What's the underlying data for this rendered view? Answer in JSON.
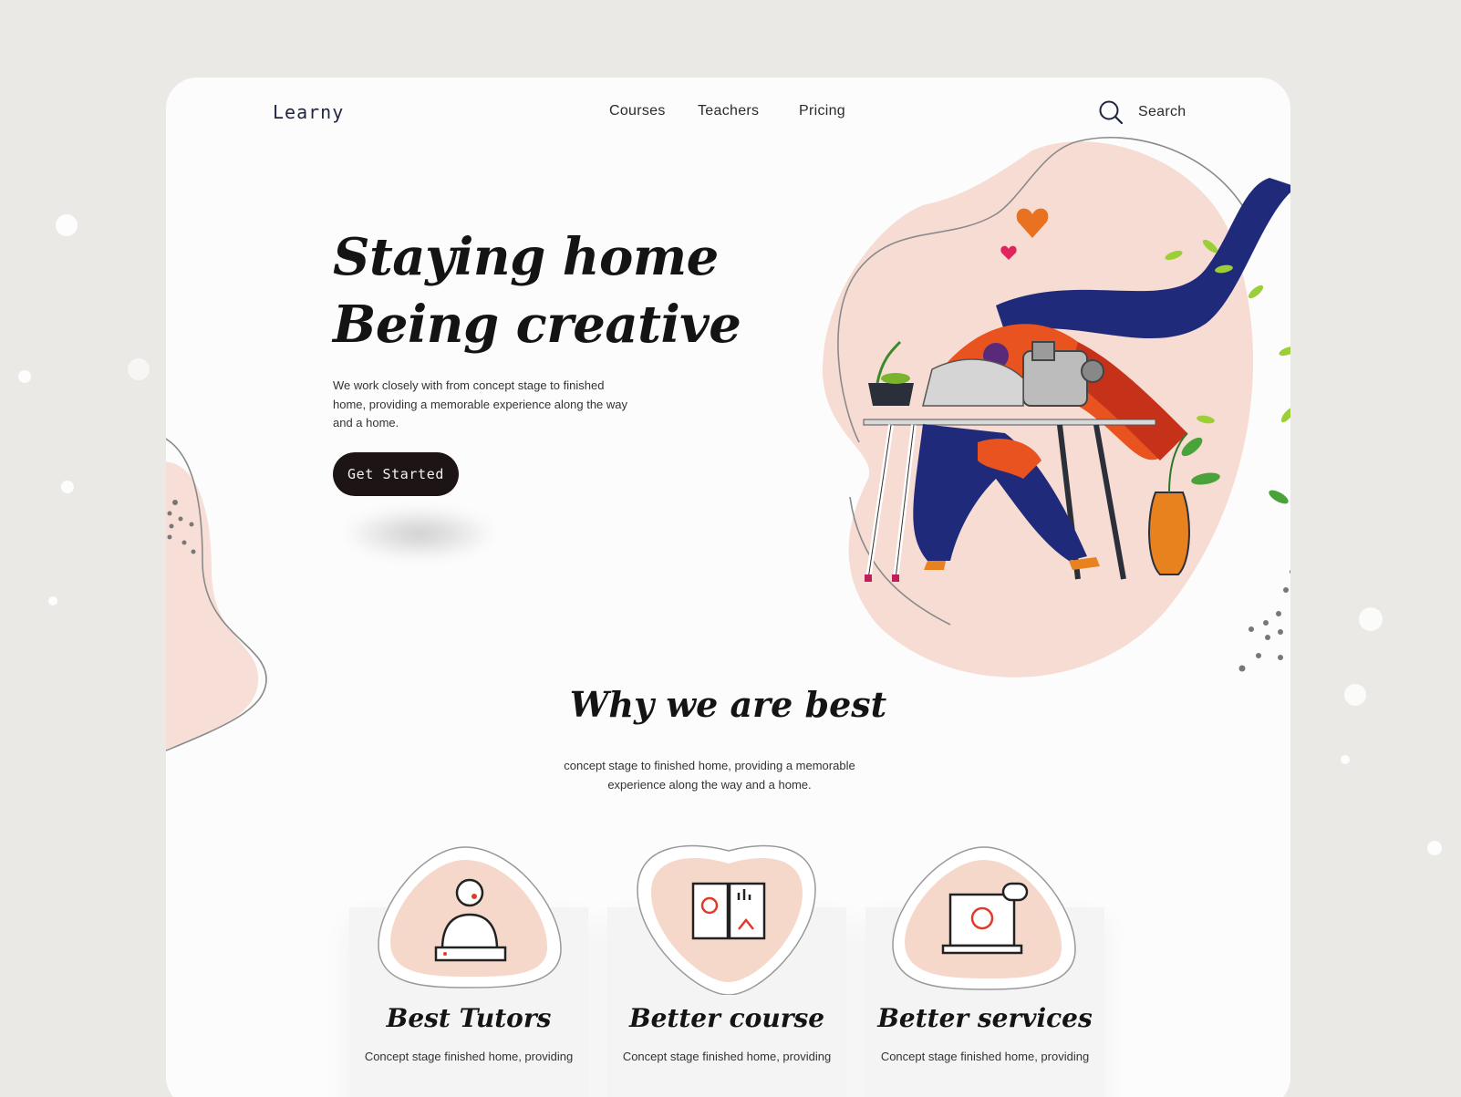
{
  "brand": {
    "logo": "Learny"
  },
  "nav": {
    "links": [
      "Courses",
      "Teachers",
      "Pricing"
    ],
    "search_label": "Search"
  },
  "hero": {
    "title_line1": "Staying home",
    "title_line2": "Being creative",
    "description": "We work closely with from concept stage to finished home, providing a memorable experience along the way and a home.",
    "cta_label": "Get Started"
  },
  "why": {
    "title": "Why we are best",
    "description": "concept stage to finished home, providing a memorable experience along the way and a home."
  },
  "features": [
    {
      "title": "Best Tutors",
      "description": "Concept stage finished home, providing",
      "icon": "tutor-icon"
    },
    {
      "title": "Better course",
      "description": "Concept stage finished home, providing",
      "icon": "course-book-icon"
    },
    {
      "title": "Better services",
      "description": "Concept stage finished home, providing",
      "icon": "support-service-icon"
    }
  ],
  "colors": {
    "background": "#ebe9e6",
    "card": "#fcfcfc",
    "blob_pink": "#f6dcd3",
    "navy": "#1f2a7a",
    "orange": "#e8531f",
    "button": "#1d1515"
  }
}
